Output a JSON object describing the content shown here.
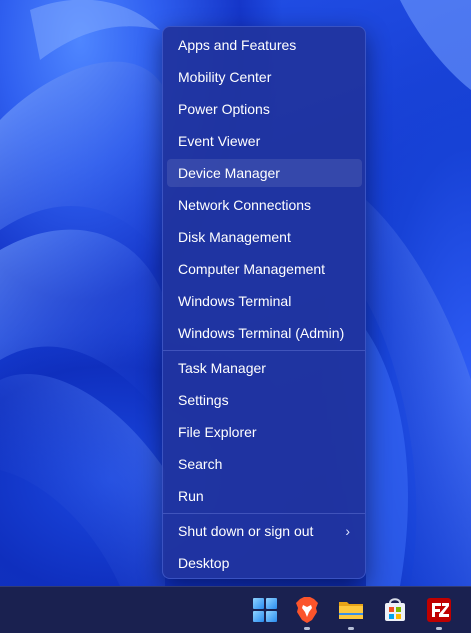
{
  "context_menu": {
    "groups": [
      [
        "Apps and Features",
        "Mobility Center",
        "Power Options",
        "Event Viewer",
        "Device Manager",
        "Network Connections",
        "Disk Management",
        "Computer Management",
        "Windows Terminal",
        "Windows Terminal (Admin)"
      ],
      [
        "Task Manager",
        "Settings",
        "File Explorer",
        "Search",
        "Run"
      ],
      [
        "Shut down or sign out",
        "Desktop"
      ]
    ],
    "hovered_item": "Device Manager",
    "submenu_indicator": "›"
  },
  "taskbar": {
    "icons": [
      "windows-start-icon",
      "brave-browser-icon",
      "file-explorer-icon",
      "microsoft-store-icon",
      "filezilla-icon"
    ],
    "running_indicators": [
      "brave-browser-icon",
      "file-explorer-icon",
      "filezilla-icon"
    ]
  },
  "colors": {
    "menu_background": "#2034a0",
    "taskbar_background": "#1a2150",
    "wallpaper_accent": "#1a3fd8"
  }
}
